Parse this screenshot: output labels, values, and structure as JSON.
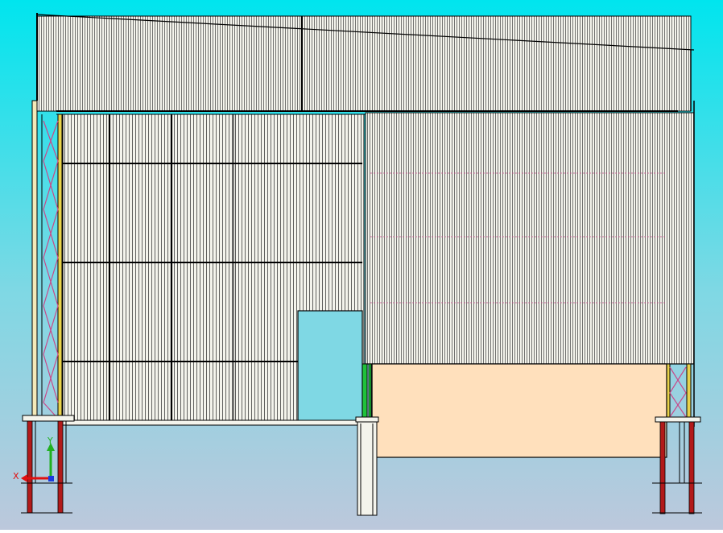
{
  "viewport": {
    "background_top": "#00E5EE",
    "background_bottom": "#BCC8DC",
    "background_mid": "#7FD8E4"
  },
  "colors": {
    "cladding_fill": "#F4F4EC",
    "cladding_line": "#3A3A3A",
    "frame_line": "#000000",
    "column_red": "#B21A1A",
    "bracing_pink": "#C84A8A",
    "panel_peach": "#FFE0BC",
    "column_cream": "#F3E9B8",
    "column_yellow": "#E8D24A",
    "accent_green": "#1FC13A",
    "axis_x": "#E01010",
    "axis_y": "#20B020",
    "axis_z": "#1A3AE0"
  },
  "axis": {
    "x_label": "X",
    "y_label": "Y"
  },
  "icons": [
    "coordinate-axis-icon"
  ]
}
